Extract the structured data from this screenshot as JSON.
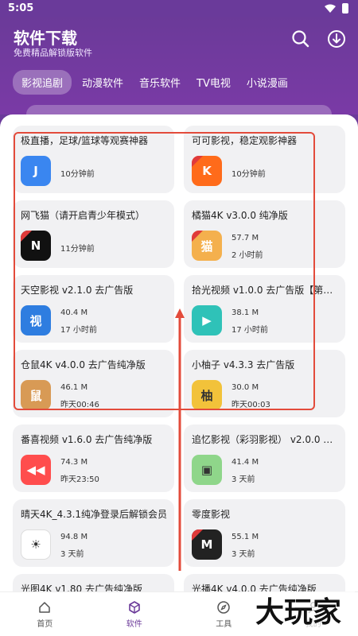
{
  "status": {
    "time": "5:05"
  },
  "header": {
    "title": "软件下载",
    "subtitle": "免费精品解锁版软件"
  },
  "tabs": [
    {
      "label": "影视追剧",
      "active": true
    },
    {
      "label": "动漫软件",
      "active": false
    },
    {
      "label": "音乐软件",
      "active": false
    },
    {
      "label": "TV电视",
      "active": false
    },
    {
      "label": "小说漫画",
      "active": false
    }
  ],
  "apps": [
    {
      "title": "极直播，足球/篮球等观赛神器",
      "size": "",
      "time": "10分钟前",
      "icon": "jizhibo-icon",
      "color": "#3a86f0",
      "badge": false,
      "glyph": "J"
    },
    {
      "title": "可可影视，稳定观影神器",
      "size": "",
      "time": "10分钟前",
      "icon": "keke-icon",
      "color": "#ff6b1a",
      "badge": true,
      "glyph": "K"
    },
    {
      "title": "网飞猫（请开启青少年模式）",
      "size": "",
      "time": "11分钟前",
      "icon": "ncat-icon",
      "color": "#111111",
      "badge": true,
      "glyph": "N"
    },
    {
      "title": "橘猫4K v3.0.0 纯净版",
      "size": "57.7 M",
      "time": "2 小时前",
      "icon": "orange-cat-icon",
      "color": "#f4b04d",
      "badge": true,
      "glyph": "猫"
    },
    {
      "title": "天空影视 v2.1.0 去广告版",
      "size": "40.4 M",
      "time": "17 小时前",
      "icon": "tiankong-icon",
      "color": "#2e7de0",
      "badge": false,
      "glyph": "视"
    },
    {
      "title": "拾光视频 v1.0.0 去广告版【第一…",
      "size": "38.1 M",
      "time": "17 小时前",
      "icon": "shiguang-icon",
      "color": "#2fc2b8",
      "badge": false,
      "glyph": "▶"
    },
    {
      "title": "仓鼠4K v4.0.0 去广告纯净版",
      "size": "46.1 M",
      "time": "昨天00:46",
      "icon": "hamster-icon",
      "color": "#d89a55",
      "badge": false,
      "glyph": "鼠"
    },
    {
      "title": "小柚子 v4.3.3 去广告版",
      "size": "30.0 M",
      "time": "昨天00:03",
      "icon": "grapefruit-icon",
      "color": "#f2c23a",
      "badge": false,
      "glyph": "柚"
    },
    {
      "title": "番喜视频 v1.6.0 去广告纯净版",
      "size": "74.3 M",
      "time": "昨天23:50",
      "icon": "fanxi-icon",
      "color": "#ff4d4d",
      "badge": false,
      "glyph": "◀◀"
    },
    {
      "title": "追忆影视（彩羽影视） v2.0.0 纯…",
      "size": "41.4 M",
      "time": "3 天前",
      "icon": "zhuiyi-icon",
      "color": "#8fd68a",
      "badge": false,
      "glyph": "▣"
    },
    {
      "title": "晴天4K_4.3.1纯净登录后解锁会员",
      "size": "94.8 M",
      "time": "3 天前",
      "icon": "sunny-icon",
      "color": "#ffffff",
      "badge": false,
      "glyph": "☀"
    },
    {
      "title": "零度影视",
      "size": "55.1 M",
      "time": "3 天前",
      "icon": "lingdu-icon",
      "color": "#222222",
      "badge": true,
      "glyph": "M"
    },
    {
      "title": "光图4K v1.80 去广告纯净版",
      "size": "",
      "time": "",
      "icon": "guangtu-icon",
      "color": "#cccccc",
      "badge": false,
      "glyph": ""
    },
    {
      "title": "光播4K v4.0.0 去广告纯净版",
      "size": "",
      "time": "",
      "icon": "guangbo-icon",
      "color": "#cccccc",
      "badge": false,
      "glyph": ""
    }
  ],
  "nav": [
    {
      "label": "首页",
      "icon": "home-icon",
      "active": false
    },
    {
      "label": "软件",
      "icon": "cube-icon",
      "active": true
    },
    {
      "label": "工具",
      "icon": "compass-icon",
      "active": false
    },
    {
      "label": "我的",
      "icon": "user-icon",
      "active": false
    }
  ],
  "watermark": {
    "text": "大玩家"
  },
  "colors": {
    "brand": "#6b3a99",
    "highlight": "#e34b3b"
  }
}
